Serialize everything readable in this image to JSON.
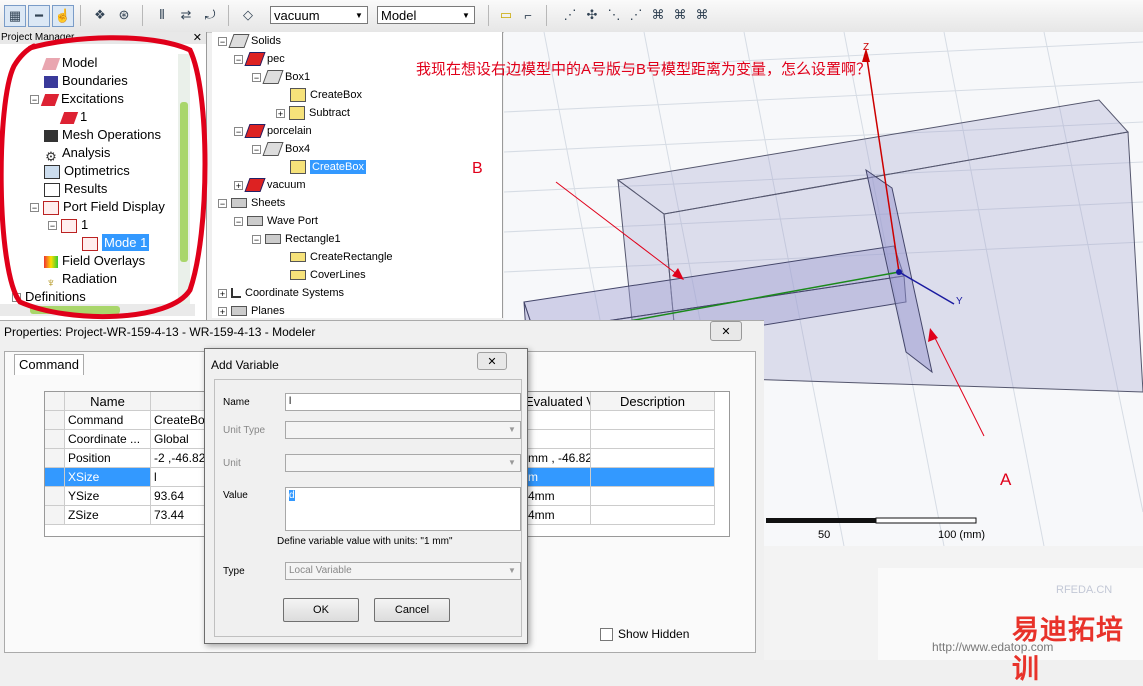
{
  "toolbar": {
    "material_select": "vacuum",
    "view_select": "Model"
  },
  "project_manager": {
    "title": "Project Manager",
    "items": [
      {
        "label": "Model"
      },
      {
        "label": "Boundaries"
      },
      {
        "label": "Excitations"
      },
      {
        "label": "1"
      },
      {
        "label": "Mesh Operations"
      },
      {
        "label": "Analysis"
      },
      {
        "label": "Optimetrics"
      },
      {
        "label": "Results"
      },
      {
        "label": "Port Field Display"
      },
      {
        "label": "1"
      },
      {
        "label": "Mode 1"
      },
      {
        "label": "Field Overlays"
      },
      {
        "label": "Radiation"
      },
      {
        "label": "Definitions"
      }
    ]
  },
  "history_tree": {
    "items": [
      {
        "label": "Solids"
      },
      {
        "label": "pec"
      },
      {
        "label": "Box1"
      },
      {
        "label": "CreateBox"
      },
      {
        "label": "Subtract"
      },
      {
        "label": "porcelain"
      },
      {
        "label": "Box4"
      },
      {
        "label": "CreateBox"
      },
      {
        "label": "vacuum"
      },
      {
        "label": "Sheets"
      },
      {
        "label": "Wave Port"
      },
      {
        "label": "Rectangle1"
      },
      {
        "label": "CreateRectangle"
      },
      {
        "label": "CoverLines"
      },
      {
        "label": "Coordinate Systems"
      },
      {
        "label": "Planes"
      }
    ]
  },
  "annotations": {
    "question": "我现在想设右边模型中的A号版与B号模型距离为变量，怎么设置啊？",
    "label_b": "B",
    "label_a": "A"
  },
  "view3d": {
    "axis_z": "Z",
    "axis_y": "Y",
    "scale_50": "50",
    "scale_100": "100 (mm)"
  },
  "properties": {
    "title": "Properties: Project-WR-159-4-13 - WR-159-4-13 - Modeler",
    "tab": "Command",
    "headers": {
      "name": "Name",
      "evaluated": "Evaluated Val...",
      "description": "Description"
    },
    "rows": [
      {
        "name": "Command",
        "value": "CreateBox",
        "evaluated": ""
      },
      {
        "name": "Coordinate ...",
        "value": "Global",
        "evaluated": ""
      },
      {
        "name": "Position",
        "value": "-2 ,-46.82...",
        "evaluated": "mm , -46.82..."
      },
      {
        "name": "XSize",
        "value": "l",
        "evaluated": "m"
      },
      {
        "name": "YSize",
        "value": "93.64",
        "evaluated": "4mm"
      },
      {
        "name": "ZSize",
        "value": "73.44",
        "evaluated": "4mm"
      }
    ],
    "show_hidden": "Show Hidden"
  },
  "dialog": {
    "title": "Add Variable",
    "name_label": "Name",
    "name_value": "l",
    "unit_type_label": "Unit Type",
    "unit_label": "Unit",
    "value_label": "Value",
    "value_value": "d",
    "hint": "Define variable value with units: \"1 mm\"",
    "type_label": "Type",
    "type_value": "Local Variable",
    "ok": "OK",
    "cancel": "Cancel"
  },
  "watermark": {
    "site_text": "RFEDA.CN",
    "brand": "易迪拓培训",
    "url": "http://www.edatop.com"
  },
  "colors": {
    "selection": "#3399ff",
    "annotation_red": "#e0001a"
  }
}
